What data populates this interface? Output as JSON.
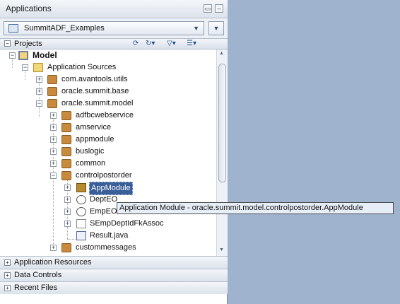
{
  "header": {
    "title": "Applications",
    "restore_label": "▭",
    "minimize_label": "–"
  },
  "app_selector": {
    "value": "SummitADF_Examples",
    "menu_label": "▾"
  },
  "projects": {
    "label": "Projects"
  },
  "tree": [
    {
      "label": "Model",
      "icon": "project-icon"
    },
    {
      "label": "Application Sources",
      "icon": "folder-icon"
    },
    {
      "label": "com.avantools.utils",
      "icon": "package-icon"
    },
    {
      "label": "oracle.summit.base",
      "icon": "package-icon"
    },
    {
      "label": "oracle.summit.model",
      "icon": "package-icon"
    },
    {
      "label": "adfbcwebservice",
      "icon": "package-icon"
    },
    {
      "label": "amservice",
      "icon": "package-icon"
    },
    {
      "label": "appmodule",
      "icon": "package-icon"
    },
    {
      "label": "buslogic",
      "icon": "package-icon"
    },
    {
      "label": "common",
      "icon": "package-icon"
    },
    {
      "label": "controlpostorder",
      "icon": "package-icon"
    },
    {
      "label": "AppModule",
      "icon": "application-module-icon"
    },
    {
      "label": "DeptEO",
      "icon": "entity-object-icon"
    },
    {
      "label": "EmpEO",
      "icon": "entity-object-icon"
    },
    {
      "label": "SEmpDeptIdFkAssoc",
      "icon": "association-icon"
    },
    {
      "label": "Result.java",
      "icon": "java-file-icon"
    },
    {
      "label": "custommessages",
      "icon": "package-icon"
    }
  ],
  "accordions": [
    "Application Resources",
    "Data Controls",
    "Recent Files"
  ],
  "tooltip": "Application Module - oracle.summit.model.controlpostorder.AppModule"
}
